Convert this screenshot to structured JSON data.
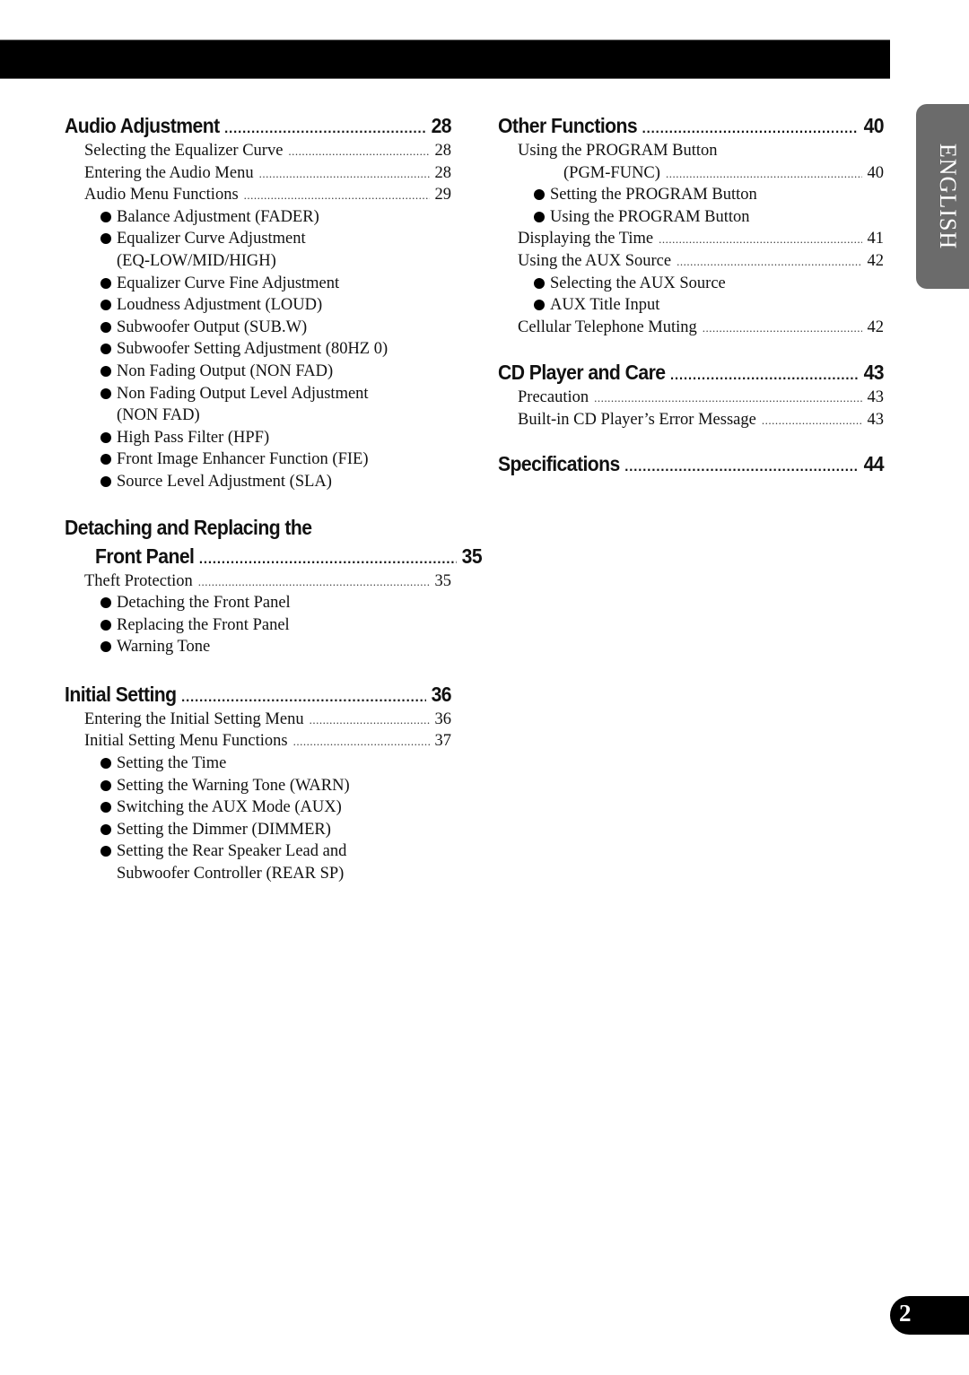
{
  "side_tab": {
    "label": "ENGLISH"
  },
  "page_number": "2",
  "left_column": {
    "audio": {
      "title": "Audio Adjustment",
      "page": "28",
      "rows": [
        {
          "label": "Selecting the Equalizer Curve",
          "page": "28"
        },
        {
          "label": "Entering the Audio Menu",
          "page": "28"
        },
        {
          "label": "Audio Menu Functions",
          "page": "29"
        }
      ],
      "bullets": [
        "Balance Adjustment (FADER)",
        "Equalizer Curve Adjustment",
        "(EQ-LOW/MID/HIGH)",
        "Equalizer Curve Fine Adjustment",
        "Loudness Adjustment (LOUD)",
        "Subwoofer Output (SUB.W)",
        "Subwoofer Setting Adjustment (80HZ 0)",
        "Non Fading Output (NON FAD)",
        "Non Fading Output Level Adjustment",
        "(NON FAD)",
        "High Pass Filter (HPF)",
        "Front Image Enhancer Function (FIE)",
        "Source Level Adjustment (SLA)"
      ]
    },
    "detach": {
      "title_line1": "Detaching and Replacing the",
      "title_line2": "Front Panel",
      "page": "35",
      "rows": [
        {
          "label": "Theft Protection",
          "page": "35"
        }
      ],
      "bullets": [
        "Detaching the Front Panel",
        "Replacing the Front Panel",
        "Warning Tone"
      ]
    },
    "initial": {
      "title": "Initial Setting",
      "page": "36",
      "rows": [
        {
          "label": "Entering the Initial Setting Menu",
          "page": "36"
        },
        {
          "label": "Initial Setting Menu Functions",
          "page": "37"
        }
      ],
      "bullets": [
        "Setting the Time",
        "Setting the Warning Tone (WARN)",
        "Switching the AUX Mode (AUX)",
        "Setting the Dimmer (DIMMER)",
        "Setting the Rear Speaker Lead and",
        "Subwoofer Controller (REAR SP)"
      ]
    }
  },
  "right_column": {
    "other": {
      "title": "Other Functions",
      "page": "40",
      "program_row_line1": "Using the PROGRAM Button",
      "program_row_line2": "(PGM-FUNC)",
      "program_row_page": "40",
      "program_bullets": [
        "Setting the PROGRAM Button",
        "Using the PROGRAM Button"
      ],
      "time_row": {
        "label": "Displaying the Time",
        "page": "41"
      },
      "aux_row": {
        "label": "Using the AUX Source",
        "page": "42"
      },
      "aux_bullets": [
        "Selecting the AUX Source",
        "AUX Title Input"
      ],
      "cell_row": {
        "label": "Cellular Telephone Muting",
        "page": "42"
      }
    },
    "cd": {
      "title": "CD Player and Care",
      "page": "43",
      "rows": [
        {
          "label": "Precaution",
          "page": "43"
        },
        {
          "label": "Built-in CD Player’s Error Message",
          "page": "43"
        }
      ]
    },
    "specs": {
      "title": "Specifications",
      "page": "44"
    }
  }
}
